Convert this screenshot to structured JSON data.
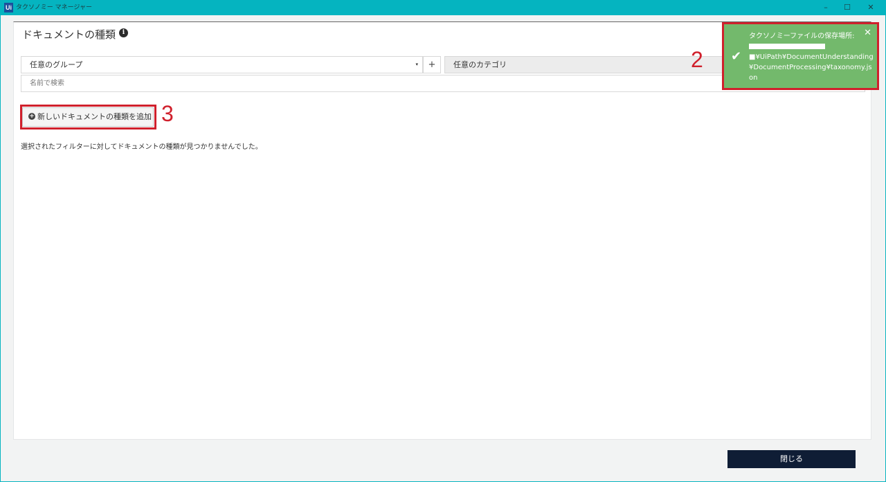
{
  "window": {
    "app_icon": "Ui",
    "title": "タクソノミー マネージャー",
    "controls": {
      "minimize": "–",
      "maximize": "☐",
      "close": "✕"
    },
    "title_bar_color": "#05b4c0"
  },
  "header": {
    "page_title": "ドキュメントの種類",
    "info_icon": "i"
  },
  "filters": {
    "group_select": "任意のグループ",
    "group_caret": "▾",
    "add_group_button": "+",
    "category_select": "任意のカテゴリ",
    "search_placeholder": "名前で検索"
  },
  "actions": {
    "add_document_type_icon": "+",
    "add_document_type_label": "新しいドキュメントの種類を追加",
    "close_button": "閉じる"
  },
  "empty_state": "選択されたフィルターに対してドキュメントの種類が見つかりませんでした。",
  "toast": {
    "check_icon": "✔",
    "title": "タクソノミーファイルの保存場所:",
    "close_icon": "✕",
    "path": "■¥UiPath¥DocumentUnderstanding¥DocumentProcessing¥taxonomy.json",
    "background_color": "#73b96c"
  },
  "annotations": {
    "toast_marker": "2",
    "add_button_marker": "3",
    "color": "#d0202c"
  }
}
